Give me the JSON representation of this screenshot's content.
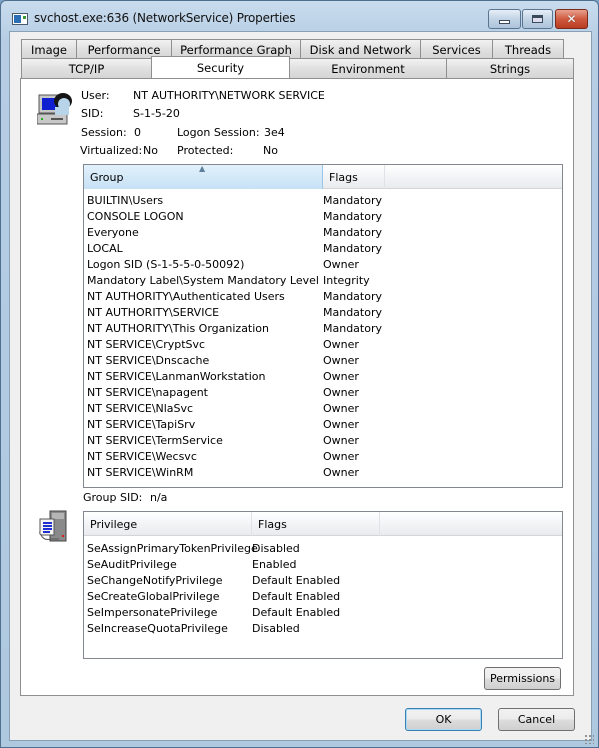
{
  "window": {
    "title": "svchost.exe:636 (NetworkService) Properties",
    "controls": {
      "minimize": "minimize-icon",
      "maximize": "maximize-icon",
      "close": "close-icon"
    }
  },
  "tabs": {
    "row1": [
      {
        "label": "Image"
      },
      {
        "label": "Performance"
      },
      {
        "label": "Performance Graph"
      },
      {
        "label": "Disk and Network"
      },
      {
        "label": "Services"
      },
      {
        "label": "Threads"
      }
    ],
    "row2": [
      {
        "label": "TCP/IP"
      },
      {
        "label": "Security",
        "active": true
      },
      {
        "label": "Environment"
      },
      {
        "label": "Strings"
      }
    ]
  },
  "security": {
    "user_label": "User:",
    "user_value": "NT AUTHORITY\\NETWORK SERVICE",
    "sid_label": "SID:",
    "sid_value": "S-1-5-20",
    "session_label": "Session:",
    "session_value": "0",
    "logon_session_label": "Logon Session:",
    "logon_session_value": "3e4",
    "virtualized_label": "Virtualized:",
    "virtualized_value": "No",
    "protected_label": "Protected:",
    "protected_value": "No",
    "groups_table": {
      "columns": [
        "Group",
        "Flags"
      ],
      "sorted_column": "Group",
      "rows": [
        [
          "BUILTIN\\Users",
          "Mandatory"
        ],
        [
          "CONSOLE LOGON",
          "Mandatory"
        ],
        [
          "Everyone",
          "Mandatory"
        ],
        [
          "LOCAL",
          "Mandatory"
        ],
        [
          "Logon SID (S-1-5-5-0-50092)",
          "Owner"
        ],
        [
          "Mandatory Label\\System Mandatory Level",
          "Integrity"
        ],
        [
          "NT AUTHORITY\\Authenticated Users",
          "Mandatory"
        ],
        [
          "NT AUTHORITY\\SERVICE",
          "Mandatory"
        ],
        [
          "NT AUTHORITY\\This Organization",
          "Mandatory"
        ],
        [
          "NT SERVICE\\CryptSvc",
          "Owner"
        ],
        [
          "NT SERVICE\\Dnscache",
          "Owner"
        ],
        [
          "NT SERVICE\\LanmanWorkstation",
          "Owner"
        ],
        [
          "NT SERVICE\\napagent",
          "Owner"
        ],
        [
          "NT SERVICE\\NlaSvc",
          "Owner"
        ],
        [
          "NT SERVICE\\TapiSrv",
          "Owner"
        ],
        [
          "NT SERVICE\\TermService",
          "Owner"
        ],
        [
          "NT SERVICE\\Wecsvc",
          "Owner"
        ],
        [
          "NT SERVICE\\WinRM",
          "Owner"
        ]
      ]
    },
    "group_sid_label": "Group SID:",
    "group_sid_value": "n/a",
    "privileges_table": {
      "columns": [
        "Privilege",
        "Flags"
      ],
      "rows": [
        [
          "SeAssignPrimaryTokenPrivilege",
          "Disabled"
        ],
        [
          "SeAuditPrivilege",
          "Enabled"
        ],
        [
          "SeChangeNotifyPrivilege",
          "Default Enabled"
        ],
        [
          "SeCreateGlobalPrivilege",
          "Default Enabled"
        ],
        [
          "SeImpersonatePrivilege",
          "Default Enabled"
        ],
        [
          "SeIncreaseQuotaPrivilege",
          "Disabled"
        ]
      ]
    },
    "permissions_button": "Permissions"
  },
  "footer": {
    "ok_label": "OK",
    "cancel_label": "Cancel"
  }
}
